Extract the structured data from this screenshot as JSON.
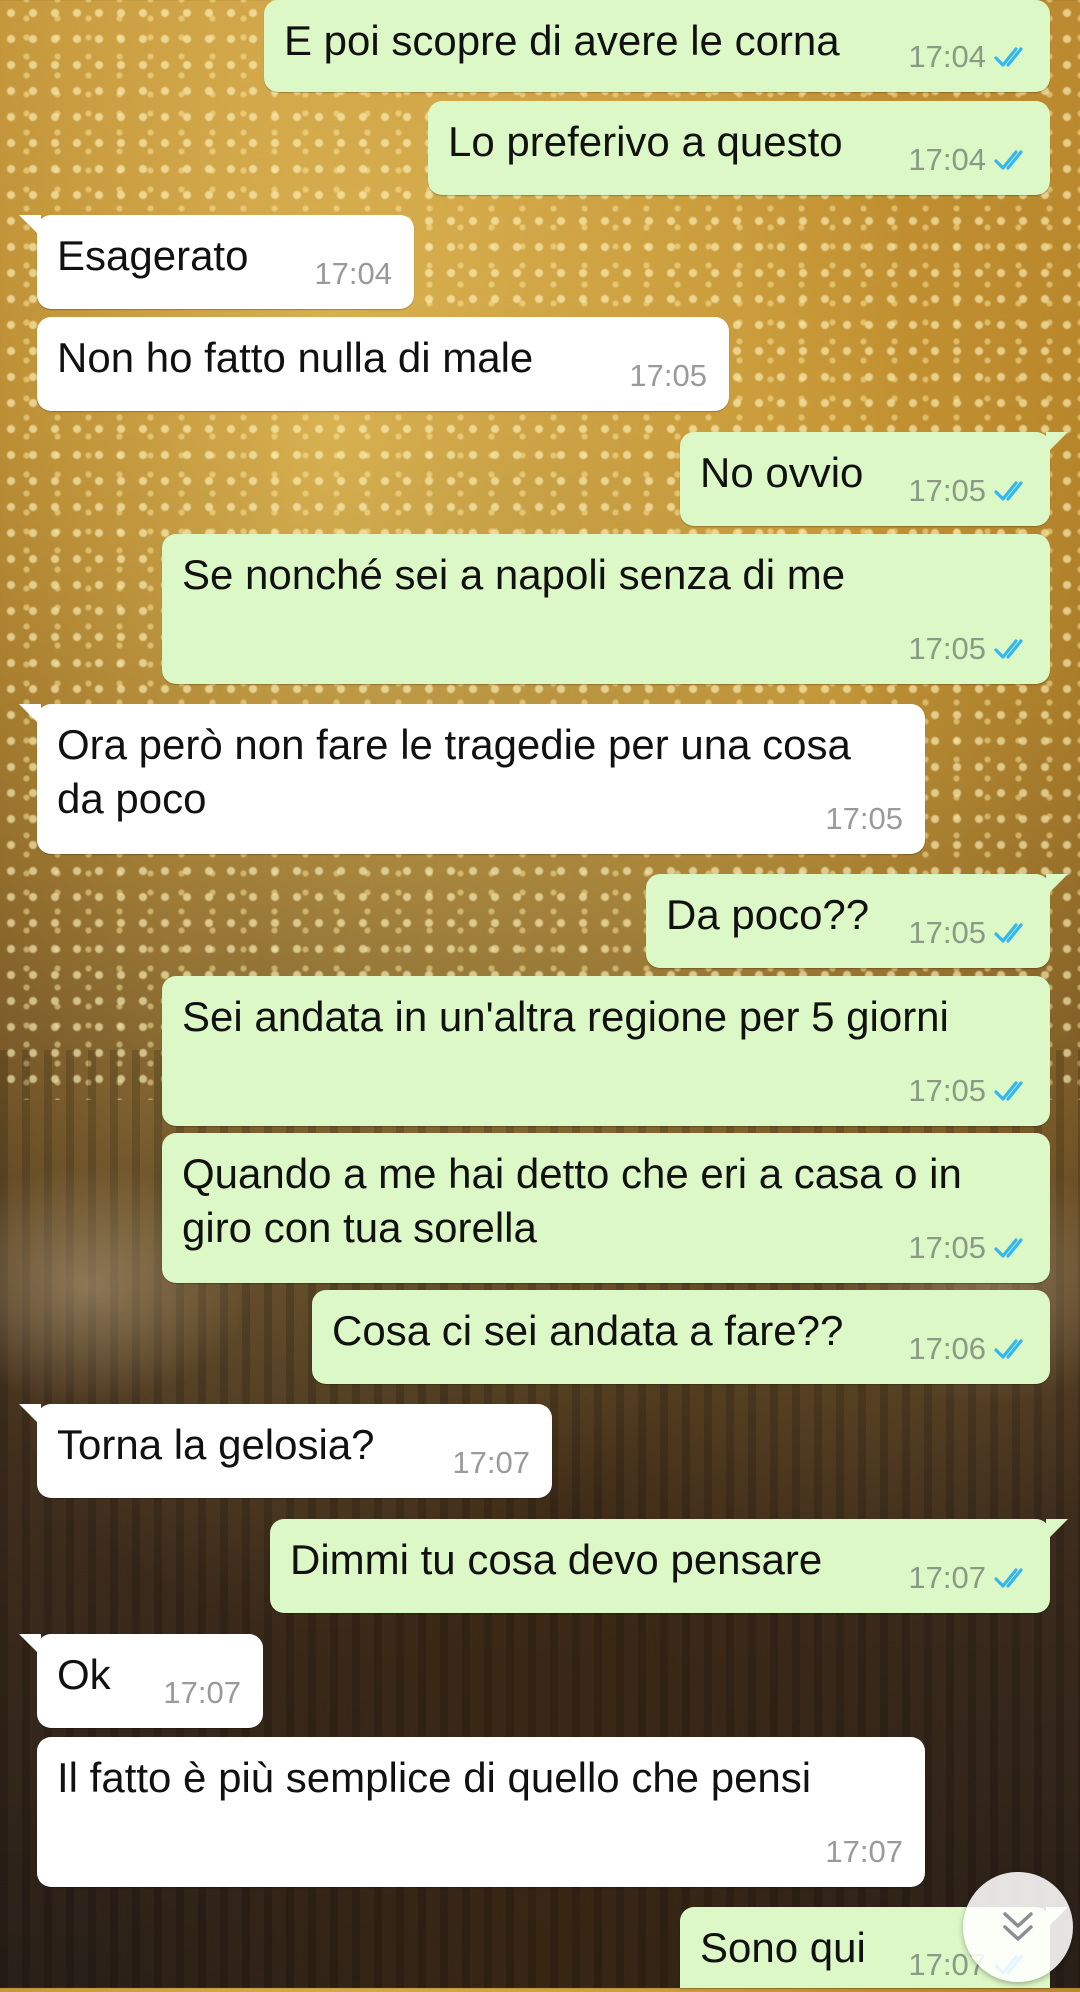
{
  "messages": [
    {
      "dir": "out",
      "text": "E poi scopre di avere le corna",
      "time": "17:04",
      "read": true
    },
    {
      "dir": "out",
      "text": "Lo preferivo a questo",
      "time": "17:04",
      "read": true
    },
    {
      "dir": "in",
      "text": "Esagerato",
      "time": "17:04"
    },
    {
      "dir": "in",
      "text": "Non ho fatto nulla di male",
      "time": "17:05"
    },
    {
      "dir": "out",
      "text": "No ovvio",
      "time": "17:05",
      "read": true
    },
    {
      "dir": "out",
      "text": "Se nonché sei a napoli senza di me",
      "time": "17:05",
      "read": true
    },
    {
      "dir": "in",
      "text": "Ora però non fare le tragedie per una cosa da poco",
      "time": "17:05"
    },
    {
      "dir": "out",
      "text": "Da poco??",
      "time": "17:05",
      "read": true
    },
    {
      "dir": "out",
      "text": "Sei andata in un'altra regione per 5 giorni",
      "time": "17:05",
      "read": true
    },
    {
      "dir": "out",
      "text": "Quando a me hai detto che eri a casa o in giro con tua sorella",
      "time": "17:05",
      "read": true
    },
    {
      "dir": "out",
      "text": "Cosa ci sei andata a fare??",
      "time": "17:06",
      "read": true
    },
    {
      "dir": "in",
      "text": "Torna la gelosia?",
      "time": "17:07"
    },
    {
      "dir": "out",
      "text": "Dimmi tu cosa devo pensare",
      "time": "17:07",
      "read": true
    },
    {
      "dir": "in",
      "text": "Ok",
      "time": "17:07"
    },
    {
      "dir": "in",
      "text": "Il fatto è più semplice di quello che pensi",
      "time": "17:07"
    },
    {
      "dir": "out",
      "text": "Sono qui",
      "time": "17:07",
      "read": true
    }
  ],
  "colors": {
    "outgoing": "#dcf8c6",
    "incoming": "#ffffff",
    "read_ticks": "#34b7f1"
  },
  "icons": {
    "read_receipt": "double-check-icon",
    "scroll": "chevron-double-down-icon"
  }
}
